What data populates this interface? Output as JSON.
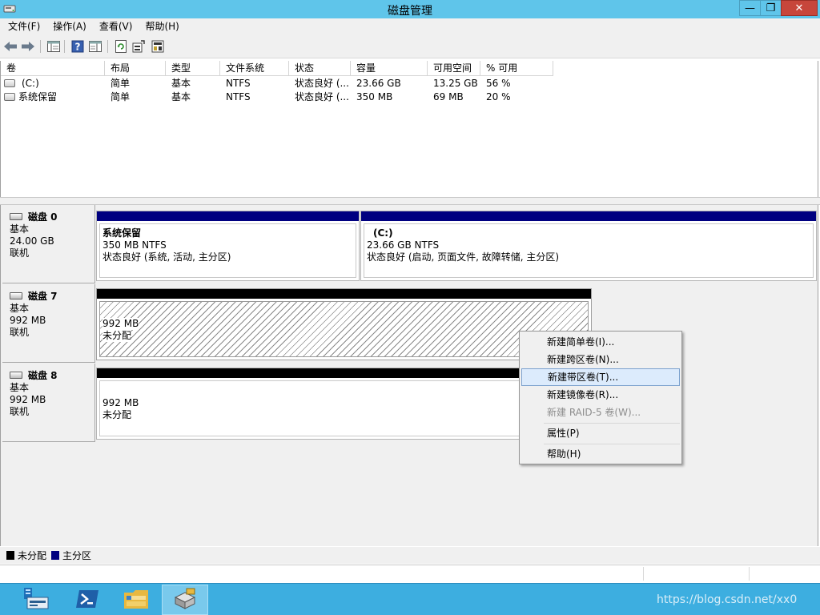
{
  "window": {
    "title": "磁盘管理",
    "minimize": "—",
    "maximize": "❐",
    "close": "✕"
  },
  "menu": [
    "文件(F)",
    "操作(A)",
    "查看(V)",
    "帮助(H)"
  ],
  "toolbar": {
    "icons": [
      "back-arrow-icon",
      "forward-arrow-icon",
      "show-hide-tree-icon",
      "help-icon",
      "properties-view-icon",
      "refresh-icon",
      "rescan-disks-icon",
      "disk-settings-icon"
    ]
  },
  "volumes": {
    "columns": [
      "卷",
      "布局",
      "类型",
      "文件系统",
      "状态",
      "容量",
      "可用空间",
      "% 可用"
    ],
    "rows": [
      [
        "(C:)",
        "简单",
        "基本",
        "NTFS",
        "状态良好 (...",
        "23.66 GB",
        "13.25 GB",
        "56 %"
      ],
      [
        "系统保留",
        "简单",
        "基本",
        "NTFS",
        "状态良好 (...",
        "350 MB",
        "69 MB",
        "20 %"
      ]
    ]
  },
  "disks": [
    {
      "name": "磁盘 0",
      "type": "基本",
      "size": "24.00 GB",
      "status": "联机",
      "partitions": [
        {
          "title": "系统保留",
          "size": "350 MB NTFS",
          "status": "状态良好 (系统, 活动, 主分区)"
        },
        {
          "title": "(C:)",
          "size": "23.66 GB NTFS",
          "status": "状态良好 (启动, 页面文件, 故障转储, 主分区)"
        }
      ]
    },
    {
      "name": "磁盘 7",
      "type": "基本",
      "size": "992 MB",
      "status": "联机",
      "partitions": [
        {
          "size": "992 MB",
          "status": "未分配"
        }
      ]
    },
    {
      "name": "磁盘 8",
      "type": "基本",
      "size": "992 MB",
      "status": "联机",
      "partitions": [
        {
          "size": "992 MB",
          "status": "未分配"
        }
      ]
    }
  ],
  "legend": [
    {
      "label": "未分配",
      "color": "#000000"
    },
    {
      "label": "主分区",
      "color": "#000080"
    }
  ],
  "context_menu": {
    "items": [
      "新建简单卷(I)...",
      "新建跨区卷(N)...",
      "新建带区卷(T)...",
      "新建镜像卷(R)...",
      "新建 RAID-5 卷(W)...",
      "属性(P)",
      "帮助(H)"
    ],
    "highlighted": "新建带区卷(T)...",
    "disabled": "新建 RAID-5 卷(W)..."
  },
  "taskbar": {
    "apps": [
      "server-manager-icon",
      "powershell-icon",
      "file-explorer-icon",
      "disk-management-icon"
    ],
    "watermark": "https://blog.csdn.net/xx0"
  },
  "colors": {
    "titlebar": "#5fc5ea",
    "taskbar": "#3daee0",
    "primary_partition": "#000080",
    "unallocated": "#000000",
    "menu_highlight": "#dcebfc"
  }
}
